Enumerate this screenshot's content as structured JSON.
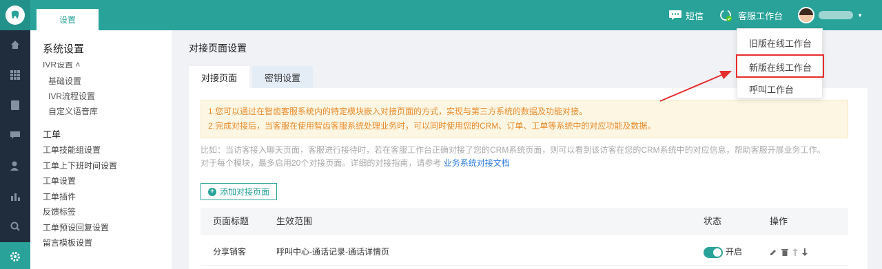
{
  "topbar": {
    "tab_settings": "设置",
    "sms_label": "短信",
    "workbench_label": "客服工作台"
  },
  "sidebar": {
    "title": "系统设置",
    "cut_item": "IVR设置 ˄",
    "ivr_items": [
      "基础设置",
      "IVR流程设置",
      "自定义语音库"
    ],
    "group_ticket": "工单",
    "ticket_items": [
      "工单技能组设置",
      "工单上下班时间设置",
      "工单设置",
      "工单插件",
      "反馈标签",
      "工单预设回复设置",
      "留言模板设置"
    ]
  },
  "main": {
    "title": "对接页面设置",
    "tab_active": "对接页面",
    "tab_inactive": "密钥设置",
    "notice_1": "1.您可以通过在智齿客服系统内的特定模块嵌入对接页面的方式，实现与第三方系统的数据及功能对接。",
    "notice_2": "2.完成对接后，当客服在使用智齿客服系统处理业务时，可以同时使用您的CRM、订单、工单等系统中的对应功能及数据。",
    "desc_1": "比如：当访客接入聊天页面，客服进行接待时，若在客服工作台正确对接了您的CRM系统页面，则可以看到该访客在您的CRM系统中的对应信息，帮助客服开展业务工作。",
    "desc_2": "对于每个模块，最多启用20个对接页面。详细的对接指南，请参考",
    "desc_link": "业务系统对接文档",
    "add_button": "添加对接页面"
  },
  "table": {
    "headers": [
      "页面标题",
      "生效范围",
      "状态",
      "操作"
    ],
    "rows": [
      {
        "title": "分享销客",
        "scope": "呼叫中心-通话记录-通话详情页",
        "status": "开启"
      }
    ]
  },
  "dropdown": {
    "items": [
      "旧版在线工作台",
      "新版在线工作台",
      "呼叫工作台"
    ]
  },
  "colors": {
    "brand": "#29a39a",
    "rail": "#1f2d3d",
    "notice_text": "#e98b2a",
    "highlight": "#e52e2e",
    "link": "#2b7be0"
  }
}
